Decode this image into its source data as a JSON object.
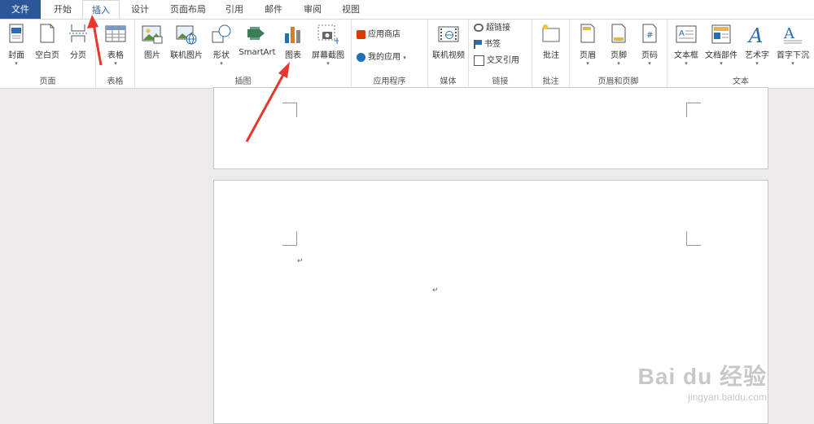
{
  "tabs": [
    "文件",
    "开始",
    "插入",
    "设计",
    "页面布局",
    "引用",
    "邮件",
    "审阅",
    "视图"
  ],
  "ribbon": {
    "pages": {
      "label": "页面",
      "cover": "封面",
      "blank": "空白页",
      "break": "分页"
    },
    "tables": {
      "label": "表格",
      "table": "表格"
    },
    "illustrations": {
      "label": "插图",
      "picture": "图片",
      "online_picture": "联机图片",
      "shapes": "形状",
      "smartart": "SmartArt",
      "chart": "图表",
      "screenshot": "屏幕截图"
    },
    "apps": {
      "label": "应用程序",
      "store": "应用商店",
      "my_apps": "我的应用"
    },
    "media": {
      "label": "媒体",
      "online_video": "联机视频"
    },
    "links": {
      "label": "链接",
      "hyperlink": "超链接",
      "bookmark": "书签",
      "cross_ref": "交叉引用"
    },
    "comments": {
      "label": "批注",
      "comment": "批注"
    },
    "header_footer": {
      "label": "页眉和页脚",
      "header": "页眉",
      "footer": "页脚",
      "page_number": "页码"
    },
    "text": {
      "label": "文本",
      "textbox": "文本框",
      "quick_parts": "文档部件",
      "wordart": "艺术字",
      "drop_cap": "首字下沉"
    }
  },
  "document": {
    "paragraph_mark": "↵"
  },
  "watermark": {
    "brand": "Bai du 经验",
    "url": "jingyan.baidu.com"
  },
  "colors": {
    "file_tab": "#2b579a",
    "arrow": "#e8372c",
    "accent": "#2b579a"
  }
}
